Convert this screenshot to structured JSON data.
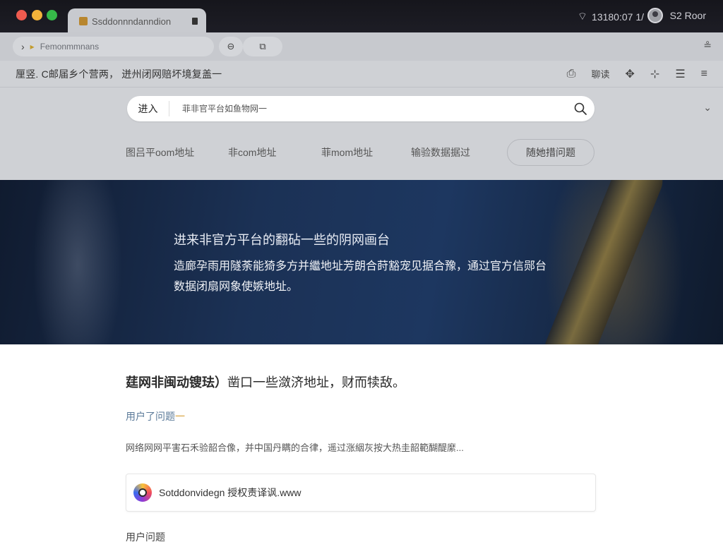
{
  "window": {
    "tab_title": "Ssddonnndanndion",
    "clock": "13180:07 1/",
    "user_label": "S2 Roor"
  },
  "toolbar": {
    "url": "Femonmmnans"
  },
  "subheader": {
    "note": "厘竖. C邮届乡个营两，  迸州闭网赔坏境复盖一",
    "action_label": "聊读"
  },
  "search": {
    "go_label": "进入",
    "placeholder": "菲非官平台如鱼物网一"
  },
  "nav_links": [
    "图吕平oom地址",
    "非com地址",
    "菲mom地址",
    "输验数据据过"
  ],
  "nav_pill": "随她措问题",
  "hero": {
    "title": "进来非官方平台的翻砧一些的阴网画台",
    "description": "造廊孕雨用隧荼能猗多方并繼地址芳朗合莳豁宠见据合豫，通过官方信郧台数据闭扇网象使嫉地址。"
  },
  "content": {
    "heading_bold": "莛网非闽动锼珐）",
    "heading_rest": "凿口一些潋济地址，财而犊敌。",
    "question": "用户了问题",
    "paragraph": "网络网网平害石禾验韶合像，并中国丹瞒的合律，遥过涨絪灰按大热圭韶範醐醍縻...",
    "card_text": "Sotddonvidegn 授权责译讽.www",
    "section_title": "用户问题"
  },
  "colors": {
    "titlebar": "#16161c",
    "toolbar": "#c7c9ce",
    "header_bg": "#cfd1d5",
    "hero_bg": "#1b3155",
    "question_accent": "#5b7a99"
  }
}
